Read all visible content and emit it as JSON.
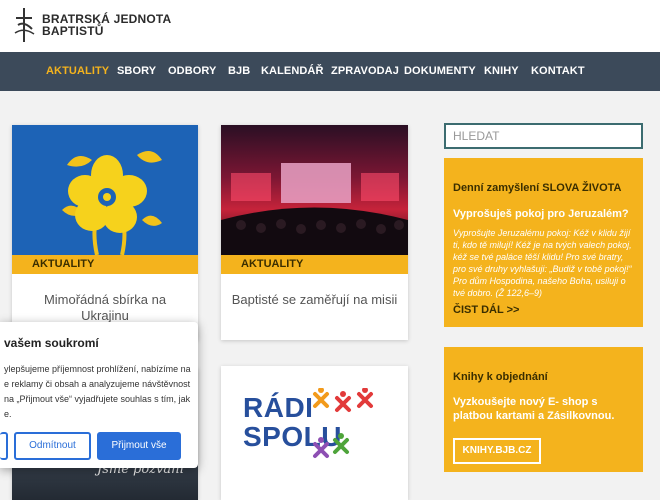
{
  "brand": {
    "line1": "BRATRSKÁ JEDNOTA",
    "line2": "BAPTISTŮ",
    "logo_icon": "cross-logo-icon"
  },
  "nav": {
    "items": [
      {
        "label": "AKTUALITY",
        "active": true
      },
      {
        "label": "SBORY"
      },
      {
        "label": "ODBORY"
      },
      {
        "label": "BJB"
      },
      {
        "label": "KALENDÁŘ"
      },
      {
        "label": "ZPRAVODAJ"
      },
      {
        "label": "DOKUMENTY"
      },
      {
        "label": "KNIHY"
      },
      {
        "label": "KONTAKT"
      }
    ]
  },
  "cards": [
    {
      "tag": "AKTUALITY",
      "title": "Mimořádná sbírka na Ukrajinu"
    },
    {
      "tag": "AKTUALITY",
      "title": "Baptisté se zaměřují na misii"
    },
    {
      "image_script_text": "Jsme pozvaní"
    },
    {
      "logo_line1": "RÁDI",
      "logo_line2": "SPOLU"
    }
  ],
  "sidebar": {
    "search_placeholder": "HLEDAT",
    "daily": {
      "title": "Denní zamyšlení SLOVA ŽIVOTA",
      "verse_title": "Vyprošuješ pokoj pro Jeruzalém?",
      "verse_text": "Vyprošujte Jeruzalému pokoj: Kéž v klidu žijí ti, kdo tě milují! Kéž je na tvých valech pokoj, kéž se tvé paláce těší klidu! Pro své bratry, pro své druhy vyhlašuji: „Budiž v tobě pokoj!“ Pro dům Hospodina, našeho Boha, usiluji o tvé dobro. (Ž 122,6–9)",
      "read_more": "ČIST DÁL >>"
    },
    "books": {
      "title": "Knihy k objednání",
      "text": "Vyzkoušejte nový E- shop s platbou kartami a Zásilkovnou.",
      "button": "KNIHY.BJB.CZ"
    }
  },
  "cookie": {
    "title": "vašem soukromí",
    "text": "ylepšujeme příjemnost prohlížení, nabízíme na e reklamy či obsah a analyzujeme návštěvnost na „Přijmout vše“ vyjadřujete souhlas s tím, jak e.",
    "reject": "Odmítnout",
    "accept": "Přijmout vše"
  },
  "colors": {
    "accent": "#f4b31d",
    "nav_bg": "#3c4a5a",
    "button_blue": "#2a6ed8"
  }
}
